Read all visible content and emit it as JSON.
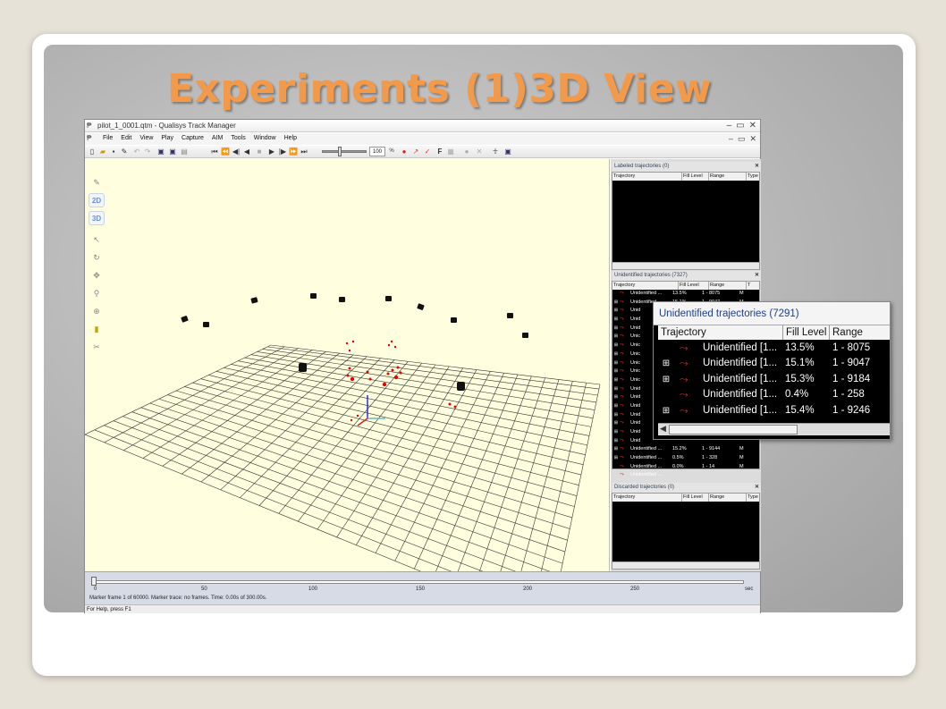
{
  "slide": {
    "title": "Experiments (1)3D View"
  },
  "window": {
    "title": "pilot_1_0001.qtm - Qualisys Track Manager",
    "menus": [
      "File",
      "Edit",
      "View",
      "Play",
      "Capture",
      "AIM",
      "Tools",
      "Window",
      "Help"
    ],
    "zoom_value": "100",
    "zoom_unit": "%"
  },
  "view_modes": {
    "two_d": "2D",
    "three_d": "3D"
  },
  "panels": {
    "labeled": {
      "title": "Labeled trajectories (0)",
      "headers": [
        "Trajectory",
        "Fill Level",
        "Range",
        "Type"
      ]
    },
    "unidentified": {
      "title": "Unidentified trajectories (7327)",
      "headers": [
        "Trajectory",
        "Fill Level",
        "Range",
        "T"
      ],
      "rows": [
        {
          "expand": "",
          "name": "Unidentified ...",
          "fill": "13.5%",
          "range": "1 - 8075",
          "type": "M"
        },
        {
          "expand": "⊞",
          "name": "Unidentified ...",
          "fill": "15.1%",
          "range": "1 - 9047",
          "type": "M"
        },
        {
          "expand": "⊞",
          "name": "Unid",
          "fill": "",
          "range": "",
          "type": ""
        },
        {
          "expand": "⊞",
          "name": "Unid",
          "fill": "",
          "range": "",
          "type": ""
        },
        {
          "expand": "⊞",
          "name": "Unid",
          "fill": "",
          "range": "",
          "type": ""
        },
        {
          "expand": "⊞",
          "name": "Unic",
          "fill": "",
          "range": "",
          "type": ""
        },
        {
          "expand": "⊞",
          "name": "Unic",
          "fill": "",
          "range": "",
          "type": ""
        },
        {
          "expand": "⊞",
          "name": "Unic",
          "fill": "",
          "range": "",
          "type": ""
        },
        {
          "expand": "⊞",
          "name": "Unic",
          "fill": "",
          "range": "",
          "type": ""
        },
        {
          "expand": "⊞",
          "name": "Unic",
          "fill": "",
          "range": "",
          "type": ""
        },
        {
          "expand": "⊞",
          "name": "Unic",
          "fill": "",
          "range": "",
          "type": ""
        },
        {
          "expand": "⊞",
          "name": "Unid",
          "fill": "",
          "range": "",
          "type": ""
        },
        {
          "expand": "⊞",
          "name": "Unid",
          "fill": "",
          "range": "",
          "type": ""
        },
        {
          "expand": "⊞",
          "name": "Unid",
          "fill": "",
          "range": "",
          "type": ""
        },
        {
          "expand": "⊞",
          "name": "Unid",
          "fill": "",
          "range": "",
          "type": ""
        },
        {
          "expand": "⊞",
          "name": "Unid",
          "fill": "",
          "range": "",
          "type": ""
        },
        {
          "expand": "⊞",
          "name": "Unid",
          "fill": "",
          "range": "",
          "type": ""
        },
        {
          "expand": "⊞",
          "name": "Unid",
          "fill": "",
          "range": "",
          "type": ""
        },
        {
          "expand": "⊞",
          "name": "Unidentified ...",
          "fill": "15.2%",
          "range": "1 - 9144",
          "type": "M"
        },
        {
          "expand": "⊞",
          "name": "Unidentified ...",
          "fill": "0.5%",
          "range": "1 - 328",
          "type": "M"
        },
        {
          "expand": "",
          "name": "Unidentified ...",
          "fill": "0.0%",
          "range": "1 - 14",
          "type": "M"
        },
        {
          "expand": "",
          "name": "Unidentified ...",
          "fill": "",
          "range": "",
          "type": ""
        }
      ]
    },
    "discarded": {
      "title": "Discarded trajectories (0)",
      "headers": [
        "Trajectory",
        "Fill Level",
        "Range",
        "Type"
      ]
    }
  },
  "timeline": {
    "ticks": [
      "0",
      "50",
      "100",
      "150",
      "200",
      "250",
      "sec"
    ],
    "status": "Marker frame 1 of 60000. Marker trace: no frames. Time: 0.00s of 300.00s."
  },
  "statusbar": {
    "text": "For Help, press F1"
  },
  "callout": {
    "title": "Unidentified trajectories (7291)",
    "headers": [
      "Trajectory",
      "Fill Level",
      "Range"
    ],
    "rows": [
      {
        "expand": "",
        "name": "Unidentified [1...",
        "fill": "13.5%",
        "range": "1 - 8075"
      },
      {
        "expand": "⊞",
        "name": "Unidentified [1...",
        "fill": "15.1%",
        "range": "1 - 9047"
      },
      {
        "expand": "⊞",
        "name": "Unidentified [1...",
        "fill": "15.3%",
        "range": "1 - 9184"
      },
      {
        "expand": "",
        "name": "Unidentified [1...",
        "fill": "0.4%",
        "range": "1 - 258"
      },
      {
        "expand": "⊞",
        "name": "Unidentified [1...",
        "fill": "15.4%",
        "range": "1 - 9246"
      }
    ]
  }
}
